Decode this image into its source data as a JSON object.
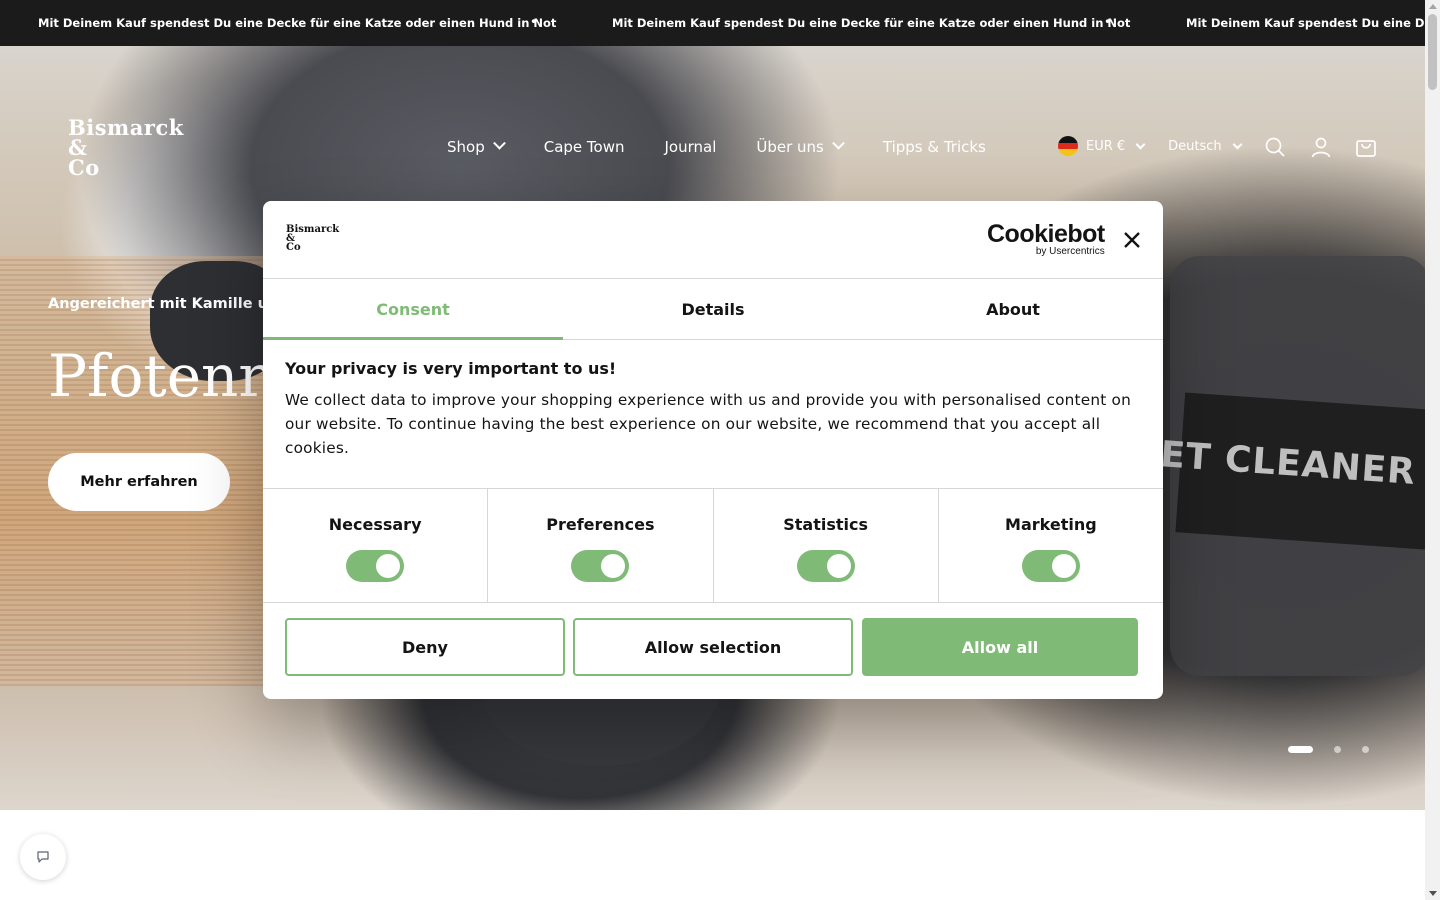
{
  "announcement": {
    "message": "Mit Deinem Kauf spendest Du eine Decke für eine Katze oder einen Hund in Not",
    "separator": "•"
  },
  "header": {
    "logo": {
      "line1": "Bismarck",
      "line2": "&",
      "line3": "Co"
    },
    "nav": [
      {
        "label": "Shop",
        "has_dropdown": true
      },
      {
        "label": "Cape Town",
        "has_dropdown": false
      },
      {
        "label": "Journal",
        "has_dropdown": false
      },
      {
        "label": "Über uns",
        "has_dropdown": true
      },
      {
        "label": "Tipps & Tricks",
        "has_dropdown": false
      }
    ],
    "currency": "EUR €",
    "language": "Deutsch",
    "icons": [
      "search-icon",
      "account-icon",
      "cart-icon"
    ]
  },
  "hero": {
    "subtitle": "Angereichert mit Kamille und L",
    "title": "Pfotenre",
    "cta": "Mehr erfahren",
    "background_text": "ET CLEANER KIT",
    "slides_total": 3,
    "active_slide": 1
  },
  "cookie_dialog": {
    "brand_name": "Cookiebot",
    "brand_sub": "by Usercentrics",
    "site_logo": {
      "line1": "Bismarck",
      "line2": "&",
      "line3": "Co"
    },
    "tabs": [
      {
        "label": "Consent",
        "active": true
      },
      {
        "label": "Details",
        "active": false
      },
      {
        "label": "About",
        "active": false
      }
    ],
    "heading": "Your privacy is very important to us!",
    "body": "We collect data to improve your shopping experience with us and provide you with personalised content on our website. To continue having the best experience on our website, we recommend that you accept all cookies.",
    "categories": [
      {
        "label": "Necessary",
        "enabled": true
      },
      {
        "label": "Preferences",
        "enabled": true
      },
      {
        "label": "Statistics",
        "enabled": true
      },
      {
        "label": "Marketing",
        "enabled": true
      }
    ],
    "buttons": {
      "deny": "Deny",
      "allow_selection": "Allow selection",
      "allow_all": "Allow all"
    }
  },
  "colors": {
    "accent": "#7fbb76",
    "announcement_bg": "#1b1b1b",
    "text_dark": "#141414"
  }
}
